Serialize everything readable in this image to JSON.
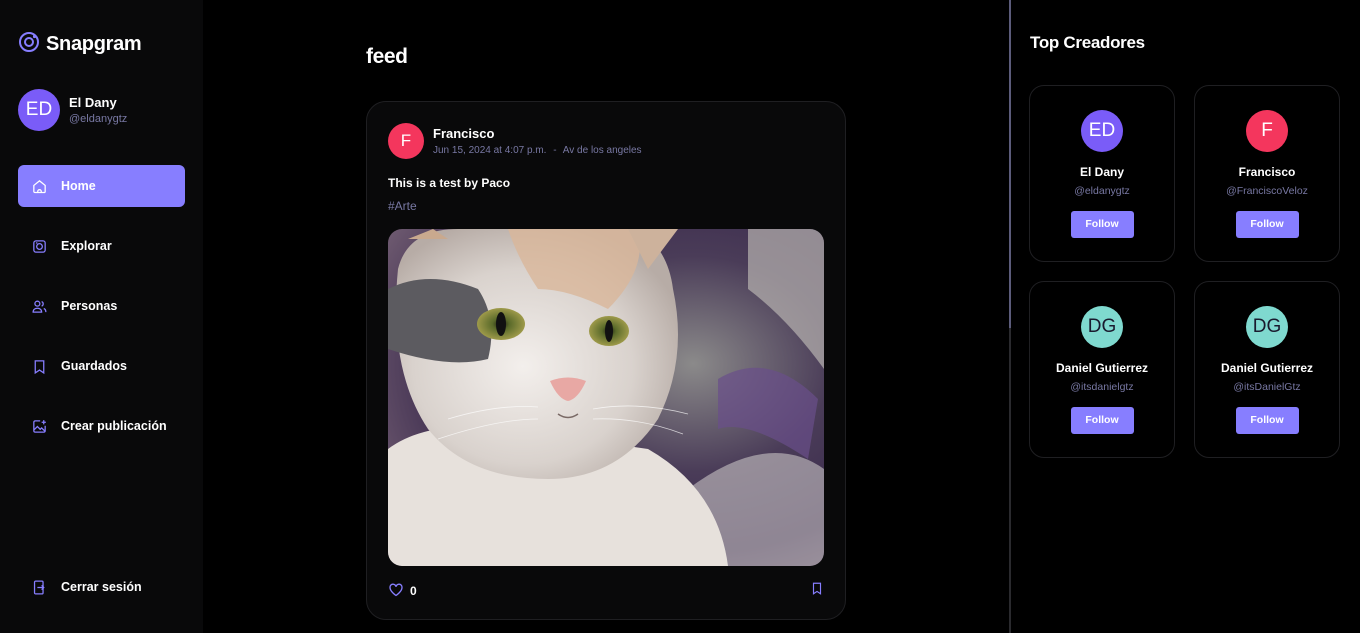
{
  "app": {
    "name": "Snapgram"
  },
  "user": {
    "initials": "ED",
    "name": "El Dany",
    "handle": "@eldanygtz"
  },
  "nav": {
    "items": [
      {
        "label": "Home",
        "icon": "home-icon",
        "active": true
      },
      {
        "label": "Explorar",
        "icon": "explore-icon"
      },
      {
        "label": "Personas",
        "icon": "people-icon"
      },
      {
        "label": "Guardados",
        "icon": "bookmark-icon"
      },
      {
        "label": "Crear publicación",
        "icon": "create-post-icon"
      }
    ],
    "logout_label": "Cerrar sesión"
  },
  "feed": {
    "title": "feed",
    "post": {
      "author_initial": "F",
      "author": "Francisco",
      "date": "Jun 15, 2024 at 4:07 p.m.",
      "separator": "-",
      "location": "Av de los angeles",
      "caption": "This is a test by Paco",
      "tag": "#Arte",
      "likes": "0",
      "image_alt": "cat photo"
    }
  },
  "top_creators": {
    "title": "Top Creadores",
    "follow_label": "Follow",
    "creators": [
      {
        "initials": "ED",
        "name": "El Dany",
        "handle": "@eldanygtz",
        "color": "#7a5cf8",
        "text_color": "#ffffff"
      },
      {
        "initials": "F",
        "name": "Francisco",
        "handle": "@FranciscoVeloz",
        "color": "#f4365d",
        "text_color": "#ffffff"
      },
      {
        "initials": "DG",
        "name": "Daniel Gutierrez",
        "handle": "@itsdanielgtz",
        "color": "#7fd9cf",
        "text_color": "#1a1a2e"
      },
      {
        "initials": "DG",
        "name": "Daniel Gutierrez",
        "handle": "@itsDanielGtz",
        "color": "#7fd9cf",
        "text_color": "#1a1a2e"
      }
    ]
  },
  "colors": {
    "accent": "#877eff",
    "muted": "#7878a3",
    "user_avatar": "#7a5cf8",
    "author_avatar": "#f4365d"
  }
}
